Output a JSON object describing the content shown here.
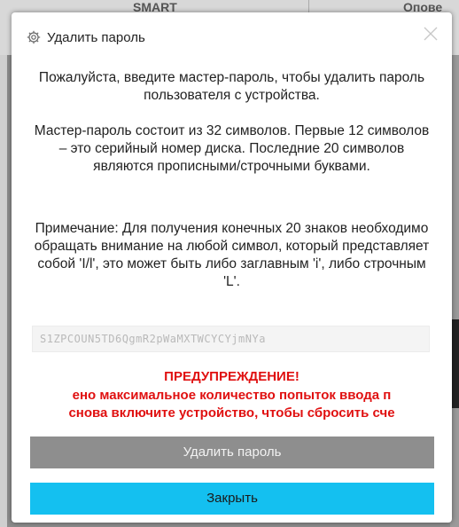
{
  "background": {
    "tab_left": "SMART",
    "tab_right": "Опове"
  },
  "dialog": {
    "title": "Удалить пароль",
    "title_icon": "gear-icon",
    "close_icon": "close-icon",
    "paragraph_1": "Пожалуйста, введите мастер-пароль, чтобы удалить пароль пользователя с устройства.",
    "paragraph_2": "Мастер-пароль состоит из 32 символов. Первые 12 символов – это серийный номер диска. Последние 20 символов являются прописными/строчными буквами.",
    "paragraph_3": "Примечание: Для получения конечных 20 знаков необходимо обращать внимание на любой символ, который представляет собой 'I/l', это может быть либо заглавным 'i', либо строчным 'L'.",
    "master_password_value": "S1ZPCOUN5TD6QgmR2pWaMXTWCYCYjmNYa",
    "warning_title": "ПРЕДУПРЕЖДЕНИЕ!",
    "warning_line_1": "ено максимальное количество попыток ввода п",
    "warning_line_2": "снова включите устройство, чтобы сбросить сче",
    "delete_button": "Удалить пароль",
    "close_button": "Закрыть"
  },
  "colors": {
    "warning": "#e01010",
    "close_button_bg": "#14c0f0",
    "delete_button_bg": "#8e8e8e"
  }
}
